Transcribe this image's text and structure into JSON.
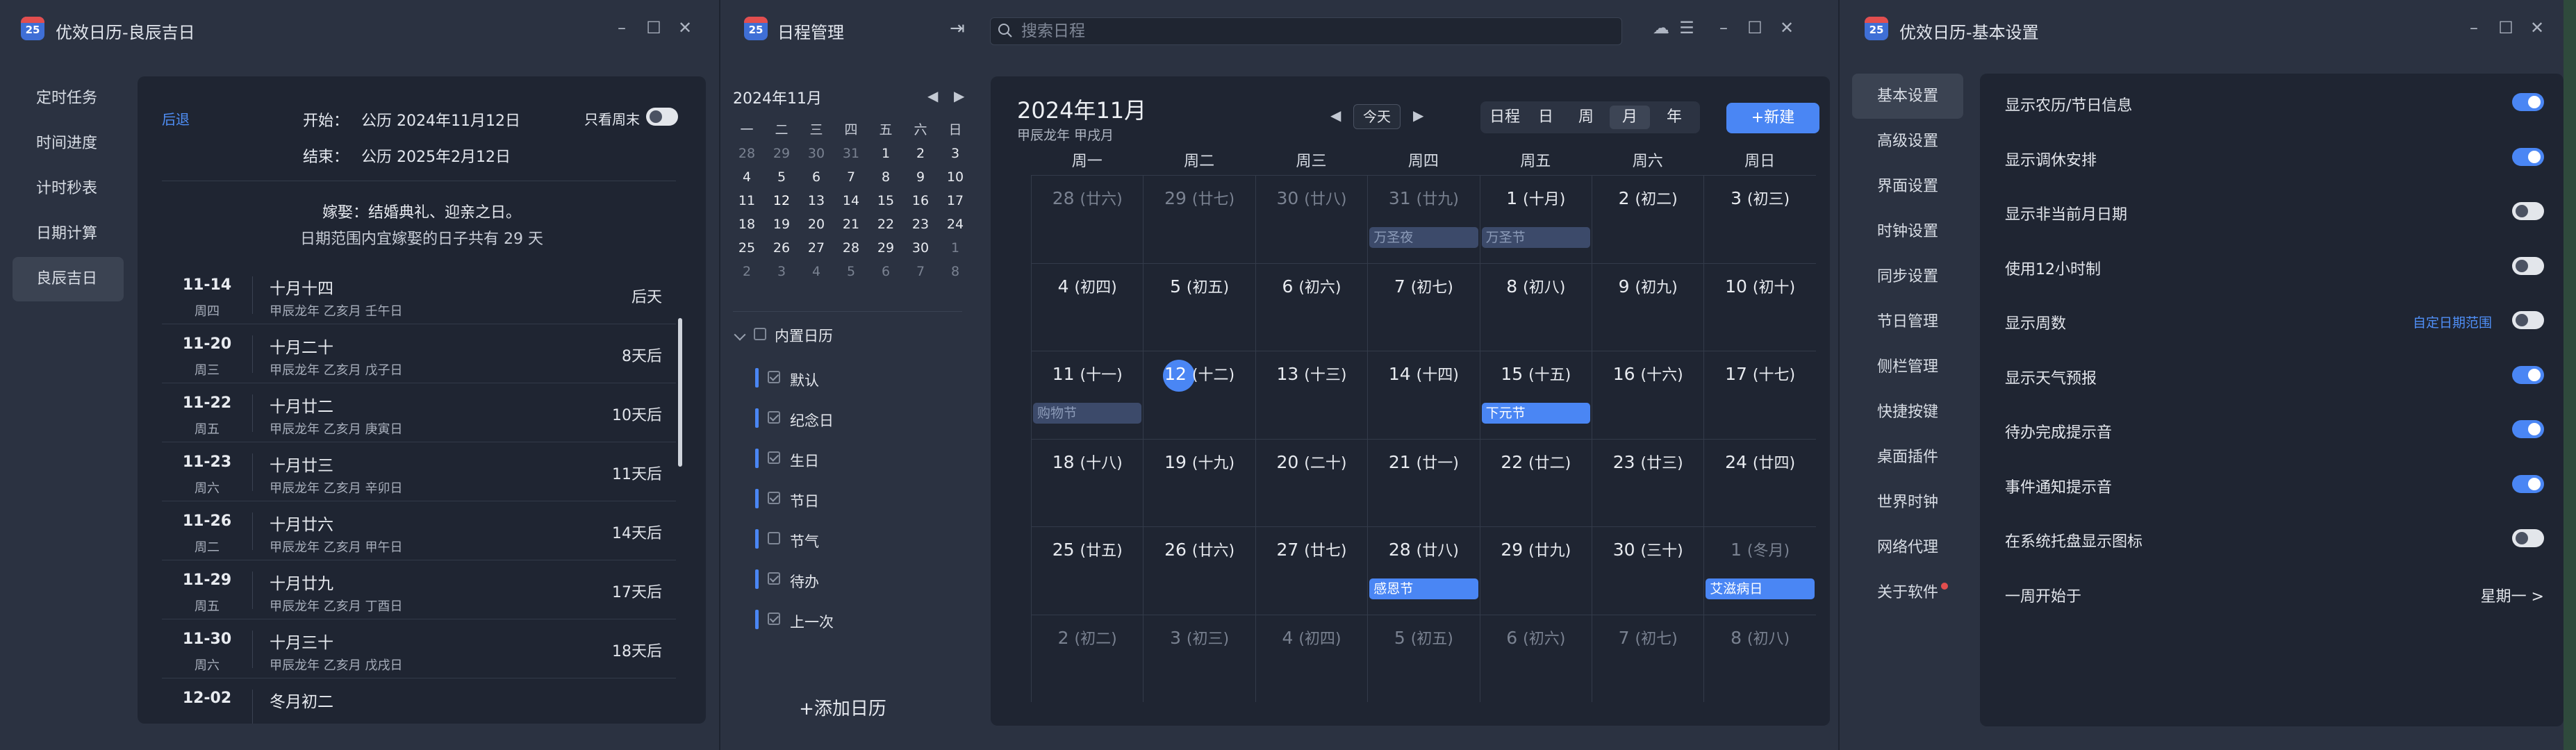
{
  "accent_color": "#4a86f4",
  "lucky_window": {
    "title": "优效日历-良辰吉日",
    "logo_text": "25",
    "nav": [
      "定时任务",
      "时间进度",
      "计时秒表",
      "日期计算",
      "良辰吉日"
    ],
    "back_label": "后退",
    "start_label": "开始：",
    "start_value": "公历 2024年11月12日",
    "end_label": "结束：",
    "end_value": "公历 2025年2月12日",
    "only_weekend_label": "只看周末",
    "tip_title": "嫁娶：结婚典礼、迎亲之日。",
    "tip_desc": "日期范围内宜嫁娶的日子共有 29 天",
    "rows": [
      {
        "date": "11-14",
        "weekday": "周四",
        "lunar": "十月十四",
        "ganzhi": "甲辰龙年 乙亥月 壬午日",
        "countdown": "后天"
      },
      {
        "date": "11-20",
        "weekday": "周三",
        "lunar": "十月二十",
        "ganzhi": "甲辰龙年 乙亥月 戊子日",
        "countdown": "8天后"
      },
      {
        "date": "11-22",
        "weekday": "周五",
        "lunar": "十月廿二",
        "ganzhi": "甲辰龙年 乙亥月 庚寅日",
        "countdown": "10天后"
      },
      {
        "date": "11-23",
        "weekday": "周六",
        "lunar": "十月廿三",
        "ganzhi": "甲辰龙年 乙亥月 辛卯日",
        "countdown": "11天后"
      },
      {
        "date": "11-26",
        "weekday": "周二",
        "lunar": "十月廿六",
        "ganzhi": "甲辰龙年 乙亥月 甲午日",
        "countdown": "14天后"
      },
      {
        "date": "11-29",
        "weekday": "周五",
        "lunar": "十月廿九",
        "ganzhi": "甲辰龙年 乙亥月 丁酉日",
        "countdown": "17天后"
      },
      {
        "date": "11-30",
        "weekday": "周六",
        "lunar": "十月三十",
        "ganzhi": "甲辰龙年 乙亥月 戊戌日",
        "countdown": "18天后"
      },
      {
        "date": "12-02",
        "weekday": "",
        "lunar": "冬月初二",
        "ganzhi": "",
        "countdown": ""
      }
    ]
  },
  "schedule_window": {
    "title": "日程管理",
    "logo_text": "25",
    "search_placeholder": "搜索日程",
    "mini_title": "2024年11月",
    "mini_weekdays": [
      "一",
      "二",
      "三",
      "四",
      "五",
      "六",
      "日"
    ],
    "mini_days": [
      [
        "28",
        "29",
        "30",
        "31",
        "1",
        "2",
        "3"
      ],
      [
        "4",
        "5",
        "6",
        "7",
        "8",
        "9",
        "10"
      ],
      [
        "11",
        "12",
        "13",
        "14",
        "15",
        "16",
        "17"
      ],
      [
        "18",
        "19",
        "20",
        "21",
        "22",
        "23",
        "24"
      ],
      [
        "25",
        "26",
        "27",
        "28",
        "29",
        "30",
        "1"
      ],
      [
        "2",
        "3",
        "4",
        "5",
        "6",
        "7",
        "8"
      ]
    ],
    "calendar_group": "内置日历",
    "calendars": [
      {
        "label": "默认",
        "checked": true,
        "color": "#4a86f4"
      },
      {
        "label": "纪念日",
        "checked": true,
        "color": "#4a86f4"
      },
      {
        "label": "生日",
        "checked": true,
        "color": "#4a86f4"
      },
      {
        "label": "节日",
        "checked": true,
        "color": "#4a86f4"
      },
      {
        "label": "节气",
        "checked": false,
        "color": "#4a86f4"
      },
      {
        "label": "待办",
        "checked": true,
        "color": "#4a86f4"
      },
      {
        "label": "上一次",
        "checked": true,
        "color": "#4a86f4"
      }
    ],
    "add_calendar_label": "+添加日历",
    "month_title": "2024年11月",
    "month_sub": "甲辰龙年 甲戌月",
    "today_label": "今天",
    "views": [
      "日程",
      "日",
      "周",
      "月",
      "年"
    ],
    "selected_view": "月",
    "new_label": "+新建",
    "weekdays": [
      "周一",
      "周二",
      "周三",
      "周四",
      "周五",
      "周六",
      "周日"
    ],
    "weeks": [
      [
        {
          "d": "28",
          "l": "(廿六)",
          "o": true
        },
        {
          "d": "29",
          "l": "(廿七)",
          "o": true
        },
        {
          "d": "30",
          "l": "(廿八)",
          "o": true
        },
        {
          "d": "31",
          "l": "(廿九)",
          "o": true,
          "e": "万圣夜",
          "p": true
        },
        {
          "d": "1",
          "l": "(十月)",
          "e": "万圣节",
          "p": true
        },
        {
          "d": "2",
          "l": "(初二)"
        },
        {
          "d": "3",
          "l": "(初三)"
        }
      ],
      [
        {
          "d": "4",
          "l": "(初四)"
        },
        {
          "d": "5",
          "l": "(初五)"
        },
        {
          "d": "6",
          "l": "(初六)"
        },
        {
          "d": "7",
          "l": "(初七)"
        },
        {
          "d": "8",
          "l": "(初八)"
        },
        {
          "d": "9",
          "l": "(初九)"
        },
        {
          "d": "10",
          "l": "(初十)"
        }
      ],
      [
        {
          "d": "11",
          "l": "(十一)",
          "e": "购物节",
          "p": true
        },
        {
          "d": "12",
          "l": "(十二)",
          "t": true
        },
        {
          "d": "13",
          "l": "(十三)"
        },
        {
          "d": "14",
          "l": "(十四)"
        },
        {
          "d": "15",
          "l": "(十五)",
          "e": "下元节"
        },
        {
          "d": "16",
          "l": "(十六)"
        },
        {
          "d": "17",
          "l": "(十七)"
        }
      ],
      [
        {
          "d": "18",
          "l": "(十八)"
        },
        {
          "d": "19",
          "l": "(十九)"
        },
        {
          "d": "20",
          "l": "(二十)"
        },
        {
          "d": "21",
          "l": "(廿一)"
        },
        {
          "d": "22",
          "l": "(廿二)"
        },
        {
          "d": "23",
          "l": "(廿三)"
        },
        {
          "d": "24",
          "l": "(廿四)"
        }
      ],
      [
        {
          "d": "25",
          "l": "(廿五)"
        },
        {
          "d": "26",
          "l": "(廿六)"
        },
        {
          "d": "27",
          "l": "(廿七)"
        },
        {
          "d": "28",
          "l": "(廿八)",
          "e": "感恩节"
        },
        {
          "d": "29",
          "l": "(廿九)"
        },
        {
          "d": "30",
          "l": "(三十)"
        },
        {
          "d": "1",
          "l": "(冬月)",
          "o": true,
          "e": "艾滋病日"
        }
      ],
      [
        {
          "d": "2",
          "l": "(初二)",
          "o": true
        },
        {
          "d": "3",
          "l": "(初三)",
          "o": true
        },
        {
          "d": "4",
          "l": "(初四)",
          "o": true
        },
        {
          "d": "5",
          "l": "(初五)",
          "o": true
        },
        {
          "d": "6",
          "l": "(初六)",
          "o": true
        },
        {
          "d": "7",
          "l": "(初七)",
          "o": true
        },
        {
          "d": "8",
          "l": "(初八)",
          "o": true
        }
      ]
    ]
  },
  "settings_window": {
    "title": "优效日历-基本设置",
    "logo_text": "25",
    "nav": [
      "基本设置",
      "高级设置",
      "界面设置",
      "时钟设置",
      "同步设置",
      "节日管理",
      "侧栏管理",
      "快捷按键",
      "桌面插件",
      "世界时钟",
      "网络代理",
      "关于软件"
    ],
    "rows": [
      {
        "label": "显示农历/节日信息",
        "on": true
      },
      {
        "label": "显示调休安排",
        "on": true
      },
      {
        "label": "显示非当前月日期",
        "on": false
      },
      {
        "label": "使用12小时制",
        "on": false
      },
      {
        "label": "显示周数",
        "on": false,
        "link": "自定日期范围"
      },
      {
        "label": "显示天气预报",
        "on": true
      },
      {
        "label": "待办完成提示音",
        "on": true
      },
      {
        "label": "事件通知提示音",
        "on": true
      },
      {
        "label": "在系统托盘显示图标",
        "on": false
      }
    ],
    "week_start_label": "一周开始于",
    "week_start_value": "星期一 >"
  }
}
